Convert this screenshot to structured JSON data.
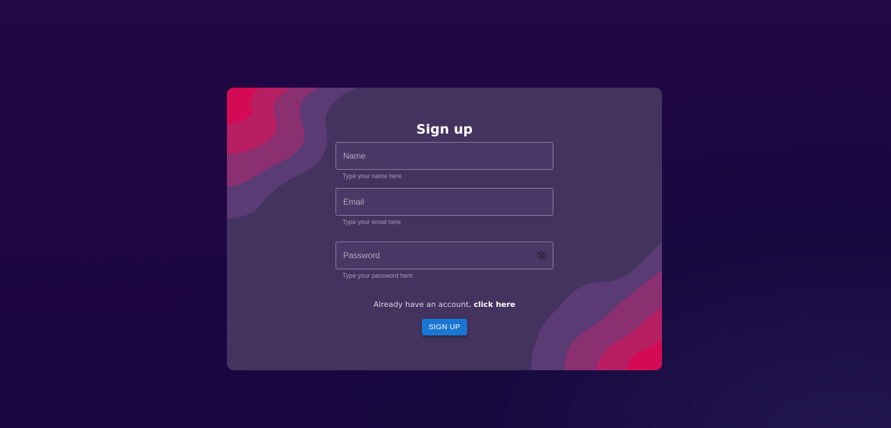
{
  "form": {
    "title": "Sign up",
    "fields": [
      {
        "placeholder": "Name",
        "helper": "Type your name here",
        "value": ""
      },
      {
        "placeholder": "Email",
        "helper": "Type your email here",
        "value": ""
      },
      {
        "placeholder": "Password",
        "helper": "Type your password here",
        "value": ""
      }
    ],
    "account_text": "Already have an account,",
    "account_link": "click here",
    "submit_label": "SIGN UP"
  },
  "icons": {
    "password_toggle": "visibility-off-icon"
  },
  "colors": {
    "background": "#1b0640",
    "card": "#44335f",
    "wave_accent": "#d0094f",
    "button": "#1976d2"
  }
}
